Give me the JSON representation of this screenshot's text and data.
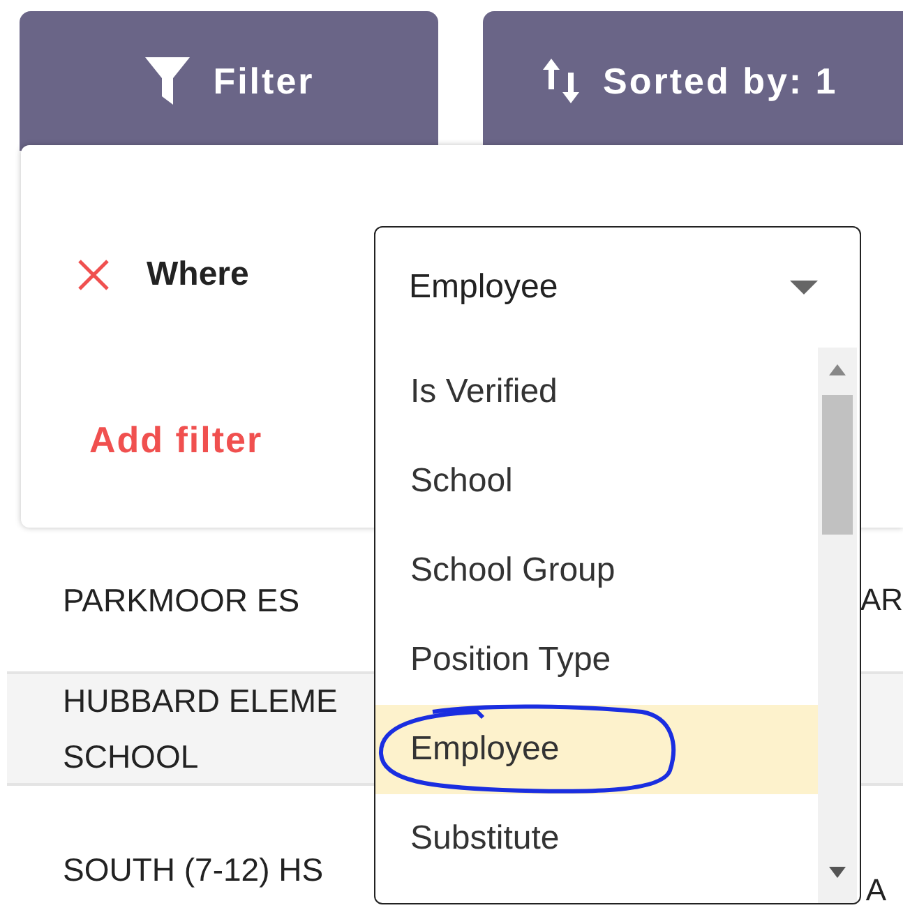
{
  "toolbar": {
    "buttons": [
      {
        "kind": "filter",
        "label": "Filter"
      },
      {
        "kind": "sort",
        "label": "Sorted by: 1"
      }
    ]
  },
  "filter_panel": {
    "conditions": [
      {
        "label": "Where",
        "field": {
          "value": "Employee",
          "expanded": true,
          "options": [
            {
              "label": "Is Verified",
              "selected": false
            },
            {
              "label": "School",
              "selected": false
            },
            {
              "label": "School Group",
              "selected": false
            },
            {
              "label": "Position Type",
              "selected": false
            },
            {
              "label": "Employee",
              "selected": true
            },
            {
              "label": "Substitute",
              "selected": false
            }
          ]
        }
      }
    ],
    "add_filter": "Add filter"
  },
  "table": {
    "rows": [
      {
        "column_1": "PARKMOOR ES",
        "column_2": "AR"
      },
      {
        "column_1": "HUBBARD ELEME\nSCHOOL"
      },
      {
        "column_1": "SOUTH (7-12) HS",
        "column_2": "A"
      }
    ]
  }
}
